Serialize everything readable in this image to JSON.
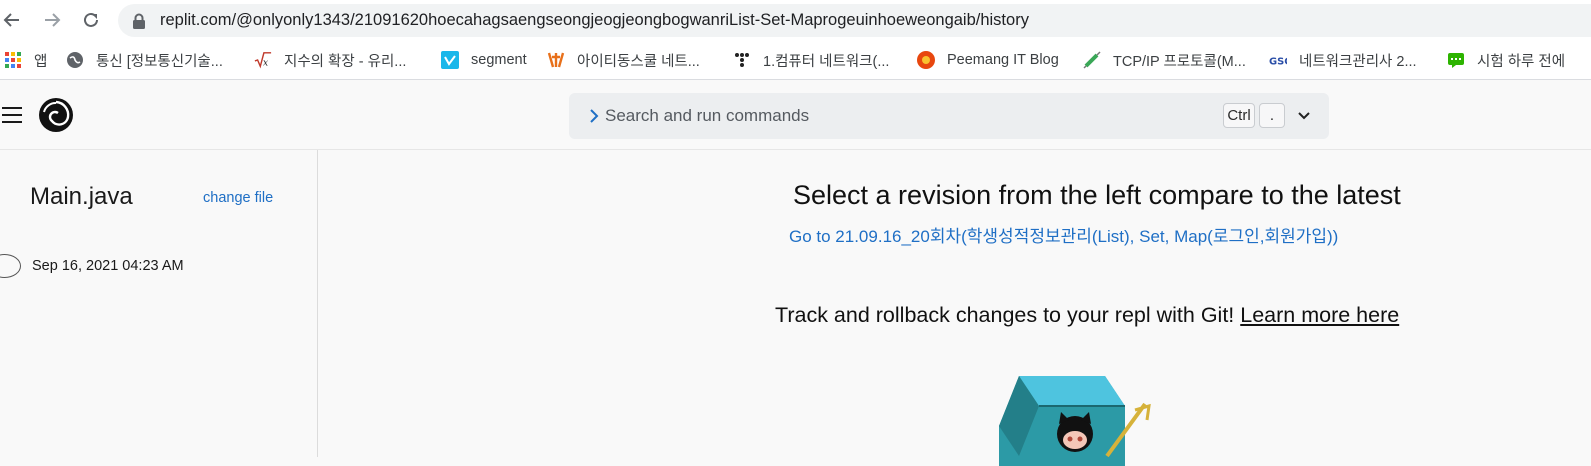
{
  "browser": {
    "url": "replit.com/@onlyonly1343/21091620hoecahagsaengseongjeogjeongbogwanriList-Set-Maprogeuinhoeweongaib/history"
  },
  "bookmarks": [
    {
      "label": "앱",
      "icon": "apps-grid-icon"
    },
    {
      "label": "통신 [정보통신기술...",
      "icon": "globe-icon"
    },
    {
      "label": "지수의 확장 - 유리...",
      "icon": "sqrt-x-icon"
    },
    {
      "label": "segment",
      "icon": "vimeo-v-icon"
    },
    {
      "label": "아이티동스쿨 네트...",
      "icon": "it-logo-icon"
    },
    {
      "label": "1.컴퓨터 네트워크(...",
      "icon": "tistory-dots-icon"
    },
    {
      "label": "Peemang IT Blog",
      "icon": "orange-badge-icon"
    },
    {
      "label": "TCP/IP 프로토콜(M...",
      "icon": "syringe-icon"
    },
    {
      "label": "네트워크관리사 2...",
      "icon": "gsc-icon"
    },
    {
      "label": "시험 하루 전에",
      "icon": "green-chat-icon"
    }
  ],
  "header": {
    "command_placeholder": "Search and run commands",
    "kbd_ctrl": "Ctrl",
    "kbd_dot": "."
  },
  "sidebar": {
    "file_name": "Main.java",
    "change_file": "change file",
    "revisions": [
      {
        "date": "Sep 16, 2021 04:23 AM"
      }
    ]
  },
  "main": {
    "title": "Select a revision from the left compare to the latest",
    "goto_link": "Go to 21.09.16_20회차(학생성적정보관리(List), Set, Map(로그인,회원가입))",
    "track_text": "Track and rollback changes to your repl with Git! ",
    "learn_more": "Learn more here"
  },
  "colors": {
    "link_blue": "#1f6fc5",
    "background": "#f9f9f9",
    "command_bar": "#eceef0"
  }
}
